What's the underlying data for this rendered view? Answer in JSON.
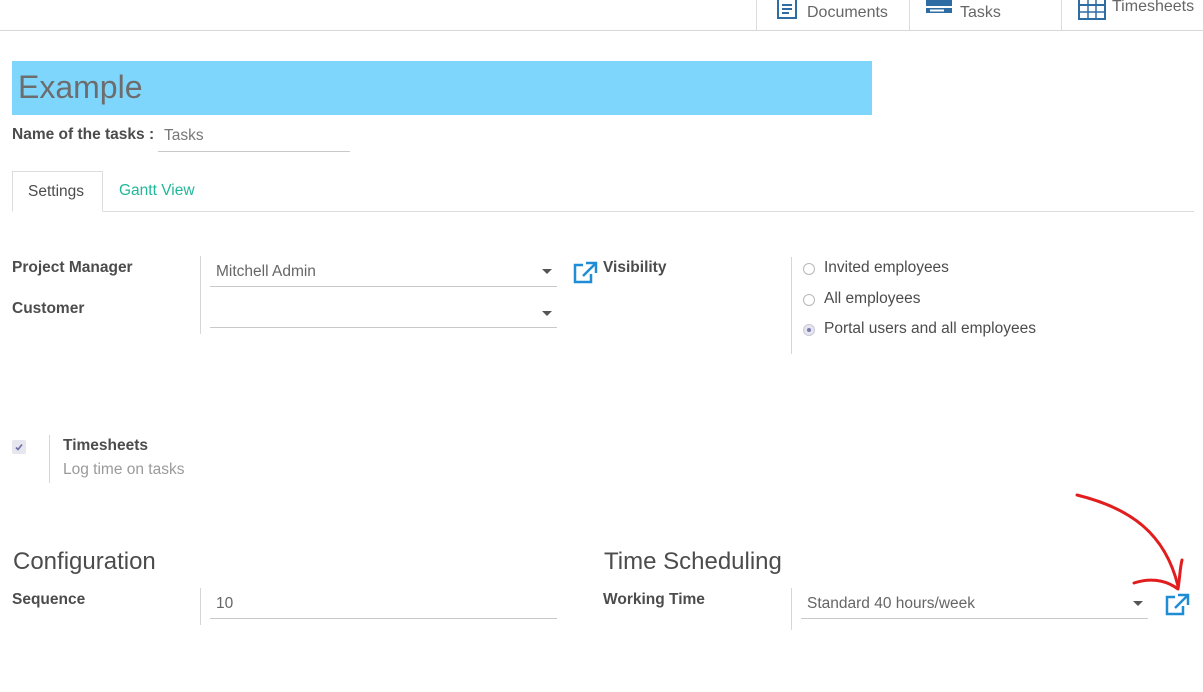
{
  "top_buttons": [
    {
      "label": "Documents"
    },
    {
      "label": "Tasks"
    },
    {
      "label": "Timesheets"
    }
  ],
  "title": "Example",
  "task_name": {
    "label": "Name of the tasks :",
    "value": "Tasks"
  },
  "tabs": [
    {
      "label": "Settings",
      "active": true
    },
    {
      "label": "Gantt View",
      "active": false
    }
  ],
  "settings": {
    "project_manager": {
      "label": "Project Manager",
      "value": "Mitchell Admin"
    },
    "customer": {
      "label": "Customer",
      "value": ""
    },
    "visibility": {
      "label": "Visibility",
      "options": [
        {
          "label": "Invited employees",
          "selected": false
        },
        {
          "label": "All employees",
          "selected": false
        },
        {
          "label": "Portal users and all employees",
          "selected": true
        }
      ]
    },
    "timesheets": {
      "label": "Timesheets",
      "description": "Log time on tasks",
      "checked": true
    }
  },
  "configuration": {
    "heading": "Configuration",
    "sequence": {
      "label": "Sequence",
      "value": "10"
    }
  },
  "time_scheduling": {
    "heading": "Time Scheduling",
    "working_time": {
      "label": "Working Time",
      "value": "Standard 40 hours/week"
    }
  },
  "colors": {
    "accent_link": "#1f8dd6",
    "title_bg": "#7fd6fd",
    "tab_link": "#21b799",
    "annotation": "#e11d1d"
  }
}
